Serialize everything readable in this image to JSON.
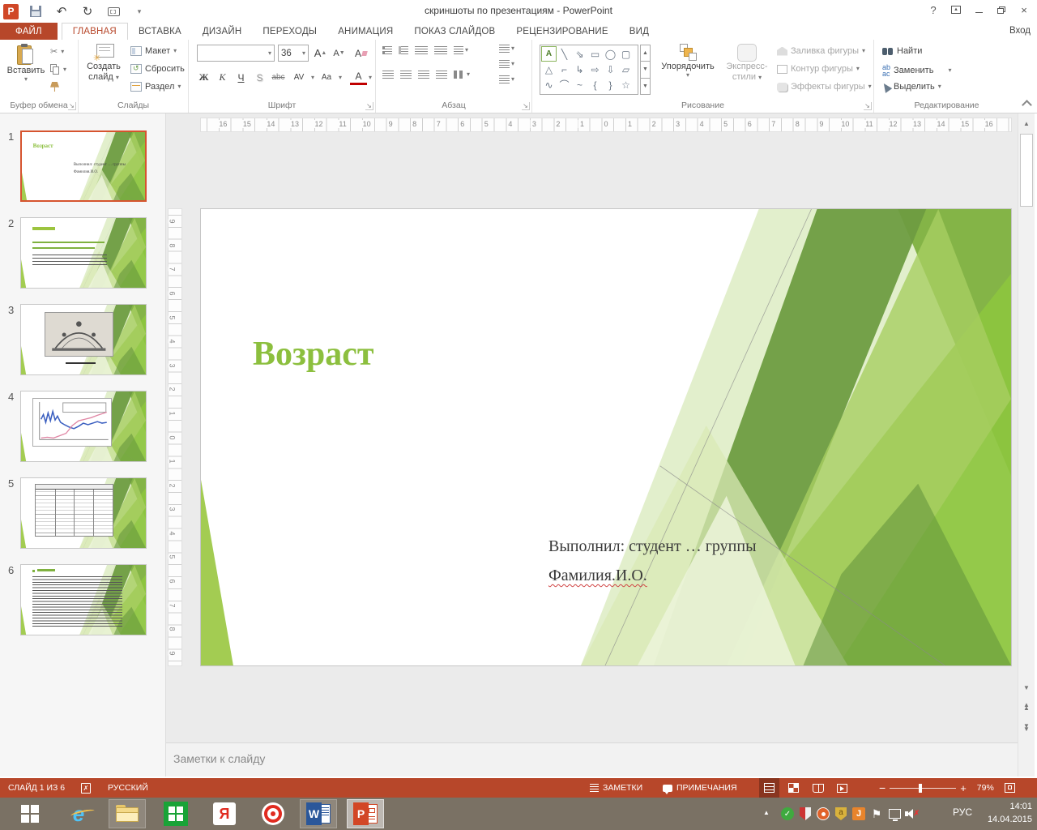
{
  "colors": {
    "accent": "#B7472A",
    "slide_title_green": "#8CBF3E",
    "theme_greens": [
      "#6E9C41",
      "#7EB03F",
      "#8DC63F",
      "#A7CE62",
      "#CBE1A2",
      "#D9E9B6"
    ],
    "taskbar_bg": "#7A7164"
  },
  "titlebar": {
    "title": "скриншоты по презентациям - PowerPoint",
    "help": "?",
    "signin": "Вход"
  },
  "qat": {
    "items": [
      {
        "name": "powerpoint-logo-icon",
        "glyph": "P"
      },
      {
        "name": "save-icon",
        "glyph": ""
      },
      {
        "name": "undo-icon",
        "glyph": "↶"
      },
      {
        "name": "redo-icon",
        "glyph": "↻"
      },
      {
        "name": "screen-clip-icon",
        "glyph": ""
      },
      {
        "name": "qat-menu-icon",
        "glyph": "▾"
      }
    ]
  },
  "tabs": {
    "items": [
      "ФАЙЛ",
      "ГЛАВНАЯ",
      "ВСТАВКА",
      "ДИЗАЙН",
      "ПЕРЕХОДЫ",
      "АНИМАЦИЯ",
      "ПОКАЗ СЛАЙДОВ",
      "РЕЦЕНЗИРОВАНИЕ",
      "ВИД"
    ],
    "active_index": 1
  },
  "ribbon": {
    "clipboard": {
      "label": "Буфер обмена",
      "paste": "Вставить"
    },
    "slides": {
      "label": "Слайды",
      "new_slide_line1": "Создать",
      "new_slide_line2": "слайд",
      "layout": "Макет",
      "reset": "Сбросить",
      "section": "Раздел"
    },
    "font": {
      "label": "Шрифт",
      "name_value": "",
      "size": "36",
      "buttons": [
        {
          "name": "bold-button",
          "glyph": "Ж"
        },
        {
          "name": "italic-button",
          "glyph": "К"
        },
        {
          "name": "underline-button",
          "glyph": "Ч"
        },
        {
          "name": "shadow-button",
          "glyph": "S"
        },
        {
          "name": "strikethrough-button",
          "glyph": "abc"
        },
        {
          "name": "char-spacing-button",
          "glyph": "AV"
        },
        {
          "name": "change-case-button",
          "glyph": "Aa"
        },
        {
          "name": "font-color-button",
          "glyph": "А"
        }
      ]
    },
    "paragraph": {
      "label": "Абзац"
    },
    "drawing": {
      "label": "Рисование",
      "arrange": "Упорядочить",
      "quick_styles_line1": "Экспресс-",
      "quick_styles_line2": "стили",
      "shape_fill": "Заливка фигуры",
      "shape_outline": "Контур фигуры",
      "shape_effects": "Эффекты фигуры",
      "shapes": [
        {
          "name": "text-box-shape",
          "glyph": "A"
        },
        {
          "name": "line-shape",
          "glyph": "╲"
        },
        {
          "name": "arrow-shape",
          "glyph": "⇘"
        },
        {
          "name": "rectangle-shape",
          "glyph": "▭"
        },
        {
          "name": "oval-shape",
          "glyph": "◯"
        },
        {
          "name": "rounded-rectangle-shape",
          "glyph": "▢"
        },
        {
          "name": "triangle-shape",
          "glyph": "△"
        },
        {
          "name": "freeform-shape",
          "glyph": "⌐"
        },
        {
          "name": "elbow-arrow-shape",
          "glyph": "↳"
        },
        {
          "name": "right-arrow-shape",
          "glyph": "⇨"
        },
        {
          "name": "down-arrow-shape",
          "glyph": "⇩"
        },
        {
          "name": "callout-shape",
          "glyph": "▱"
        },
        {
          "name": "scribble-shape",
          "glyph": "∿"
        },
        {
          "name": "arc-shape",
          "glyph": "⌒"
        },
        {
          "name": "curve-shape",
          "glyph": "~"
        },
        {
          "name": "left-brace-shape",
          "glyph": "{"
        },
        {
          "name": "right-brace-shape",
          "glyph": "}"
        },
        {
          "name": "star-shape",
          "glyph": "☆"
        }
      ]
    },
    "editing": {
      "label": "Редактирование",
      "find": "Найти",
      "replace": "Заменить",
      "select": "Выделить"
    }
  },
  "rulers": {
    "horizontal": [
      "16",
      "15",
      "14",
      "13",
      "12",
      "11",
      "10",
      "9",
      "8",
      "7",
      "6",
      "5",
      "4",
      "3",
      "2",
      "1",
      "0",
      "1",
      "2",
      "3",
      "4",
      "5",
      "6",
      "7",
      "8",
      "9",
      "10",
      "11",
      "12",
      "13",
      "14",
      "15",
      "16"
    ],
    "vertical": [
      "9",
      "8",
      "7",
      "6",
      "5",
      "4",
      "3",
      "2",
      "1",
      "0",
      "1",
      "2",
      "3",
      "4",
      "5",
      "6",
      "7",
      "8",
      "9"
    ]
  },
  "slide_panel": {
    "thumbnails": [
      {
        "number": "1",
        "kind": "title",
        "selected": true
      },
      {
        "number": "2",
        "kind": "bullets",
        "selected": false
      },
      {
        "number": "3",
        "kind": "image",
        "selected": false
      },
      {
        "number": "4",
        "kind": "chart",
        "selected": false
      },
      {
        "number": "5",
        "kind": "table",
        "selected": false
      },
      {
        "number": "6",
        "kind": "text",
        "selected": false
      }
    ]
  },
  "slide": {
    "title": "Возраст",
    "subtitle_line1": "Выполнил: студент … группы",
    "subtitle_line2": "Фамилия.И.О."
  },
  "notes": {
    "placeholder": "Заметки к слайду"
  },
  "statusbar": {
    "slide_count": "СЛАЙД 1 ИЗ 6",
    "language": "РУССКИЙ",
    "notes_btn": "ЗАМЕТКИ",
    "comments_btn": "ПРИМЕЧАНИЯ",
    "zoom": "79%"
  },
  "taskbar": {
    "apps": [
      {
        "name": "start-button",
        "open": false,
        "selected": false
      },
      {
        "name": "internet-explorer",
        "open": false,
        "selected": false
      },
      {
        "name": "file-explorer",
        "open": true,
        "selected": false
      },
      {
        "name": "windows-store",
        "open": false,
        "selected": false
      },
      {
        "name": "yandex-search",
        "open": false,
        "selected": false
      },
      {
        "name": "yandex-browser",
        "open": false,
        "selected": false
      },
      {
        "name": "word",
        "open": true,
        "selected": false
      },
      {
        "name": "powerpoint",
        "open": true,
        "selected": true
      }
    ],
    "tray": {
      "icons": [
        "hidden-icons",
        "antivirus",
        "defender",
        "record",
        "amigo",
        "java",
        "flag",
        "network",
        "volume-muted"
      ],
      "language": "РУС",
      "time": "14:01",
      "date": "14.04.2015"
    }
  }
}
